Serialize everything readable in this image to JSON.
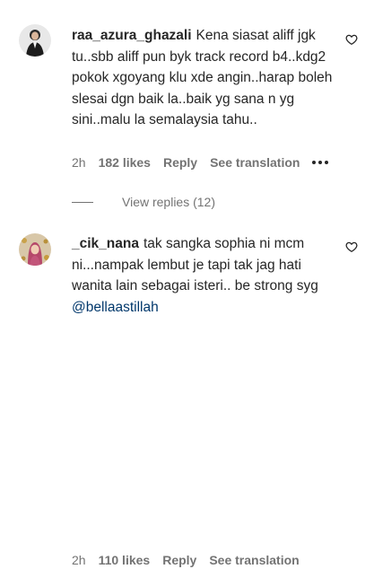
{
  "comments": [
    {
      "username": "raa_azura_ghazali",
      "text": "Kena siasat aliff jgk tu..sbb aliff pun byk track record b4..kdg2 pokok xgoyang klu xde angin..harap boleh slesai dgn baik la..baik yg sana n yg sini..malu la semalaysia tahu..",
      "mention": "",
      "time": "2h",
      "likes": "182 likes",
      "reply": "Reply",
      "translate": "See translation",
      "like_icon": "heart-outline-icon",
      "more_icon": "more-dots-icon"
    },
    {
      "username": "_cik_nana",
      "text": "tak sangka sophia ni mcm ni...nampak lembut je tapi tak jag hati wanita lain sebagai isteri.. be strong syg ",
      "mention": "@bellaastillah",
      "time": "2h",
      "likes": "110 likes",
      "reply": "Reply",
      "translate": "See translation",
      "like_icon": "heart-outline-icon"
    }
  ],
  "view_replies": "View replies (12)",
  "colors": {
    "text": "#262626",
    "secondary": "#737373",
    "mention": "#00376b"
  }
}
